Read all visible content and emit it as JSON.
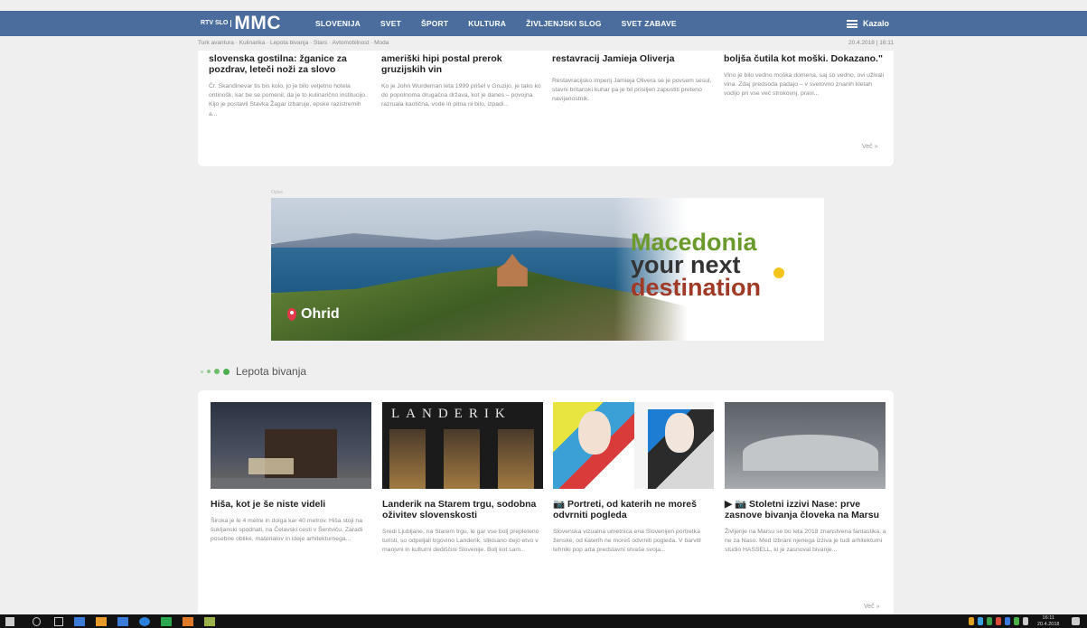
{
  "header": {
    "logo_small": "RTV SLO",
    "logo_main": "MMC",
    "nav": [
      "SLOVENIJA",
      "SVET",
      "ŠPORT",
      "KULTURA",
      "ŽIVLJENJSKI SLOG",
      "SVET ZABAVE"
    ],
    "menu_label": "Kazalo",
    "brand_color": "#4a6d9d"
  },
  "subbar": {
    "links": "Turk avantura · Kulinarika · Lepota bivanja · Stars · Avtomobilnost · Moda",
    "date": "20.4.2018 | 16:11"
  },
  "top_articles": [
    {
      "title": "slovenska gostilna: žganice za pozdrav, leteči noži za slovo",
      "excerpt": "Čr. Skandinevar tis bis kolo, jo je bilo vetjetno hotela ontinošk, kar be se pomenil, da je to kulinarično institucijo. Kljo je postavil Stavka Žagar izbaruje, epske razistremih a..."
    },
    {
      "title": "ameriški hipi postal prerok gruzijskih vin",
      "excerpt": "Ko je John Wurdeman leta 1999 prišel v Gruzijo, je tako ko do popolnoma drugačna država, kot je danes – povojna razruala kaotična, vode in pitna ni bilo, izpadi..."
    },
    {
      "title": "restavracij Jamieja Oliverja",
      "excerpt": "Restavracijsko imperij Jamieja Olivera se je povsem sesul, stavni britanski kuhar pa je bil prisiljen zapustiti preteno navijanostnik."
    },
    {
      "title": "boljša čutila kot moški. Dokazano.\"",
      "excerpt": "Vino je bilo vedno moška domena, saj so vedno, ovi uživali vina. Zdaj predsoda padajo – v svetovno znanih kletah vodijo pri vse več strokovnj, pravi...",
      "more": "Več »"
    }
  ],
  "banner": {
    "ad_label": "Oglas",
    "place": "Ohrid",
    "line1": "Macedonia",
    "line2": "your next",
    "line3": "destination"
  },
  "section": {
    "title": "Lepota bivanja",
    "accent_color": "#4cae4c"
  },
  "bottom_articles": [
    {
      "image_text": "",
      "title": "Hiša, kot je še niste videli",
      "excerpt": "Široka je le 4 metre in dolga kar 40 metrov. Hiša stoji na šukljanski spodnati, na Čelavski cesti v Šentviču. Zaradi posebne oblike, materialov in ideje arhitekturnega..."
    },
    {
      "image_text": "LANDERIK",
      "title": "Landerik na Starem trgu, sodobna oživitev slovenskosti",
      "excerpt": "Sredi Ljubljane, na Starem trgu, le gar vse bolj prepleteno turisti, so odpeljali trgovino Landerik, slikisano dejo etvo v manjvni in kulturni dediščini Slovenije. Bolj kot sam..."
    },
    {
      "image_text": "",
      "title": "Portreti, od katerih ne moreš odvrniti pogleda",
      "icons": [
        "camera-icon"
      ],
      "excerpt": "Slovenska vizualna umetnica ena Slovenijen portretka ženske, od katerih ne moreš odvrniti pogleda. V barvitl tehniki pop arta predstavni stvaše svoja..."
    },
    {
      "image_text": "",
      "title": "Stoletni izzivi Nase: prve zasnove bivanja človeka na Marsu",
      "icons": [
        "video-icon",
        "camera-icon"
      ],
      "excerpt": "Življenje na Marsu se bo leta 2018 znanstvena fantastika, a ne za Naso. Med Izbrani njenega izziva je tudi arhitekturni studio HASSELL, ki je zasnoval bivanje...",
      "more": "Več »"
    }
  ],
  "taskbar": {
    "time": "16:11",
    "date": "20.4.2018"
  }
}
